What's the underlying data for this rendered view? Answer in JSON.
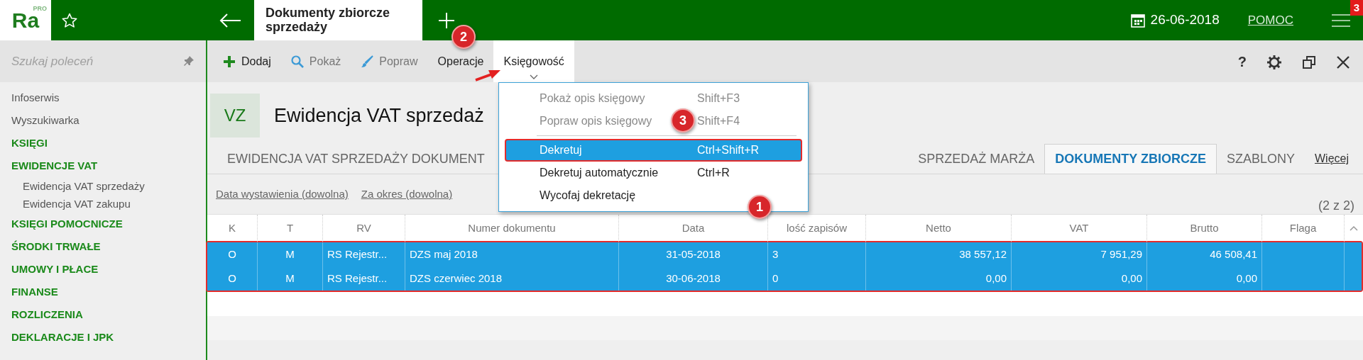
{
  "app": {
    "logo": "Ra",
    "logo_sup": "PRO",
    "tab_title": "Dokumenty zbiorcze sprzedaży",
    "date": "26-06-2018",
    "help": "POMOC",
    "notification_count": "3"
  },
  "sidebar": {
    "search_placeholder": "Szukaj poleceń",
    "items": [
      {
        "label": "Infoserwis",
        "kind": "link"
      },
      {
        "label": "Wyszukiwarka",
        "kind": "link"
      },
      {
        "label": "KSIĘGI",
        "kind": "section"
      },
      {
        "label": "EWIDENCJE VAT",
        "kind": "section",
        "children": [
          {
            "label": "Ewidencja VAT sprzedaży",
            "kind": "link"
          },
          {
            "label": "Ewidencja VAT zakupu",
            "kind": "link"
          }
        ]
      },
      {
        "label": "KSIĘGI POMOCNICZE",
        "kind": "section"
      },
      {
        "label": "ŚRODKI TRWAŁE",
        "kind": "section"
      },
      {
        "label": "UMOWY I PŁACE",
        "kind": "section"
      },
      {
        "label": "FINANSE",
        "kind": "section"
      },
      {
        "label": "ROZLICZENIA",
        "kind": "section"
      },
      {
        "label": "DEKLARACJE I JPK",
        "kind": "section"
      }
    ]
  },
  "toolbar": {
    "buttons": [
      {
        "label": "Dodaj",
        "disabled": false,
        "selected": false
      },
      {
        "label": "Pokaż",
        "disabled": true,
        "selected": false
      },
      {
        "label": "Popraw",
        "disabled": true,
        "selected": false
      },
      {
        "label": "Operacje",
        "disabled": false,
        "selected": false
      },
      {
        "label": "Księgowość",
        "disabled": false,
        "selected": true
      }
    ],
    "help_label": "?"
  },
  "header": {
    "badge": "VZ",
    "title": "Ewidencja VAT sprzedaż"
  },
  "tabs": [
    {
      "label": "EWIDENCJA VAT SPRZEDAŻY DOKUMENT",
      "selected": false
    },
    {
      "label": "SPRZEDAŻ MARŻA",
      "selected": false
    },
    {
      "label": "DOKUMENTY ZBIORCZE",
      "selected": true
    },
    {
      "label": "SZABLONY",
      "selected": false
    }
  ],
  "more_label": "Więcej",
  "filters": [
    "Data wystawienia (dowolna)",
    "Za okres (dowolna)"
  ],
  "record_count": "(2 z 2)",
  "table": {
    "outlined": true,
    "columns": [
      "K",
      "T",
      "RV",
      "Numer dokumentu",
      "Data",
      "lość zapisów",
      "Netto",
      "VAT",
      "Brutto",
      "Flaga"
    ],
    "rows": [
      {
        "selected": true,
        "cells": [
          "O",
          "M",
          "RS Rejestr...",
          "DZS maj 2018",
          "31-05-2018",
          "3",
          "38 557,12",
          "7 951,29",
          "46 508,41",
          ""
        ]
      },
      {
        "selected": true,
        "cells": [
          "O",
          "M",
          "RS Rejestr...",
          "DZS czerwiec 2018",
          "30-06-2018",
          "0",
          "0,00",
          "0,00",
          "0,00",
          ""
        ]
      }
    ]
  },
  "menu": {
    "items": [
      {
        "kind": "item",
        "label": "Pokaż opis księgowy",
        "shortcut": "Shift+F3",
        "disabled": true,
        "selected": false,
        "outlined": false
      },
      {
        "kind": "item",
        "label": "Popraw opis księgowy",
        "shortcut": "Shift+F4",
        "disabled": true,
        "selected": false,
        "outlined": false
      },
      {
        "kind": "separator"
      },
      {
        "kind": "item",
        "label": "Dekretuj",
        "shortcut": "Ctrl+Shift+R",
        "disabled": false,
        "selected": true,
        "outlined": true
      },
      {
        "kind": "item",
        "label": "Dekretuj automatycznie",
        "shortcut": "Ctrl+R",
        "disabled": false,
        "selected": false,
        "outlined": false
      },
      {
        "kind": "item",
        "label": "Wycofaj dekretację",
        "disabled": false,
        "selected": false,
        "outlined": false
      }
    ]
  },
  "callouts": [
    "1",
    "2",
    "3"
  ]
}
